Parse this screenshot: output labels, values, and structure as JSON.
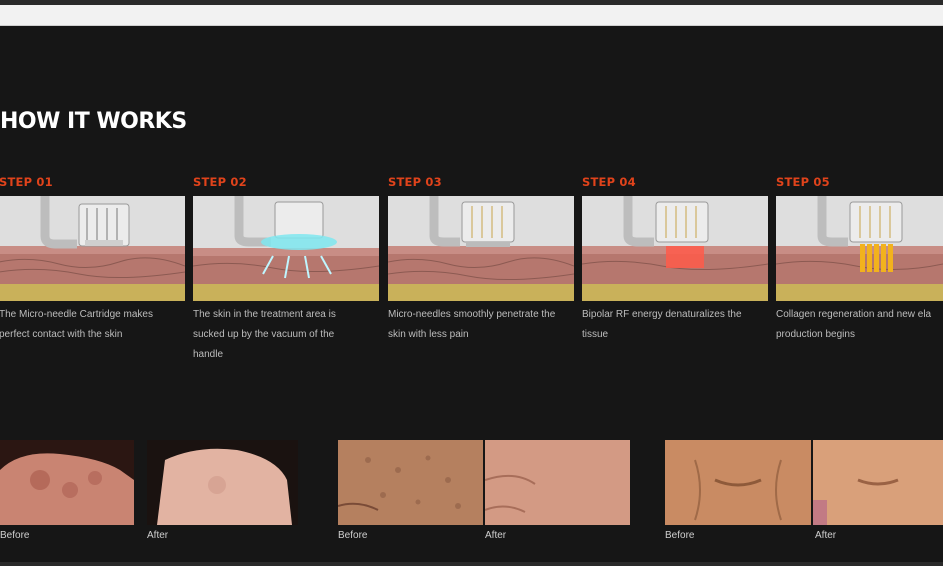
{
  "section_title": "HOW IT WORKS",
  "steps": [
    {
      "label": "STEP 01",
      "text": [
        "The Micro-needle Cartridge makes",
        "perfect contact with the skin"
      ]
    },
    {
      "label": "STEP 02",
      "text": [
        "The skin in the treatment area is",
        "sucked up by the vacuum of the",
        "handle"
      ]
    },
    {
      "label": "STEP 03",
      "text": [
        "Micro-needles smoothly penetrate the",
        "skin with less pain"
      ]
    },
    {
      "label": "STEP 04",
      "text": [
        "Bipolar RF energy denaturalizes the",
        "tissue"
      ]
    },
    {
      "label": "STEP 05",
      "text": [
        "Collagen regeneration and new ela",
        "production begins"
      ]
    }
  ],
  "comparisons": [
    {
      "before": "Before",
      "after": "After",
      "subject": "hands"
    },
    {
      "before": "Before",
      "after": "After",
      "subject": "cheek"
    },
    {
      "before": "Before",
      "after": "After",
      "subject": "mouth"
    }
  ],
  "colors": {
    "accent": "#e0431b",
    "background": "#161616",
    "title": "#ffffff"
  }
}
